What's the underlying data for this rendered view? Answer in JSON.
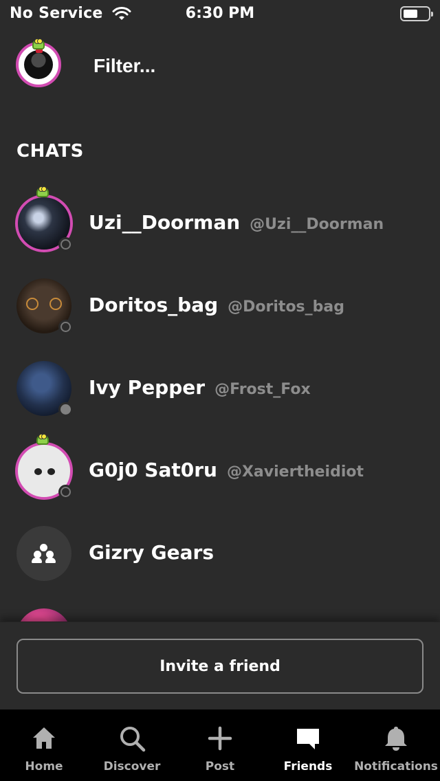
{
  "status_bar": {
    "carrier": "No Service",
    "time": "6:30 PM",
    "wifi_icon": "wifi-icon",
    "battery_icon": "battery-icon"
  },
  "header": {
    "filter_label": "Filter..."
  },
  "section_title": "CHATS",
  "chats": [
    {
      "name": "Uzi__Doorman",
      "handle": "@Uzi__Doorman",
      "has_ring": true,
      "presence": "offline"
    },
    {
      "name": "Doritos_bag",
      "handle": "@Doritos_bag",
      "has_ring": false,
      "presence": "offline"
    },
    {
      "name": "Ivy Pepper",
      "handle": "@Frost_Fox",
      "has_ring": false,
      "presence": "online"
    },
    {
      "name": "G0j0 Sat0ru",
      "handle": "@Xaviertheidiot",
      "has_ring": true,
      "presence": "offline"
    },
    {
      "name": "Gizry Gears",
      "handle": "",
      "is_group": true
    }
  ],
  "invite_label": "Invite a friend",
  "tabs": [
    {
      "label": "Home",
      "icon": "home-icon",
      "active": false
    },
    {
      "label": "Discover",
      "icon": "search-icon",
      "active": false
    },
    {
      "label": "Post",
      "icon": "plus-icon",
      "active": false
    },
    {
      "label": "Friends",
      "icon": "chat-bubble-icon",
      "active": true
    },
    {
      "label": "Notifications",
      "icon": "bell-icon",
      "active": false
    }
  ],
  "colors": {
    "background": "#2b2b2b",
    "tab_bar": "#000000",
    "ring": "#d24cb2",
    "handle_text": "#8d8d8d"
  }
}
